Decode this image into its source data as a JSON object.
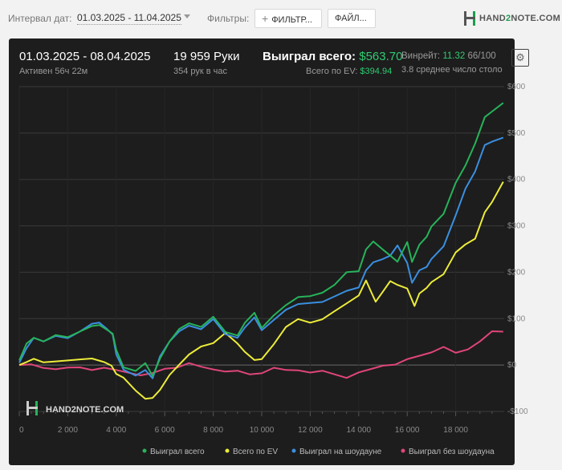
{
  "toolbar": {
    "date_label": "Интервал дат:",
    "date_range": "01.03.2025 - 11.04.2025",
    "filters_label": "Фильтры:",
    "filter_button": "ФИЛЬТР...",
    "files_button": "ФАЙЛ..."
  },
  "logo": {
    "pre": "HAND",
    "two": "2",
    "post": "NOTE.COM"
  },
  "summary": {
    "period": "01.03.2025 - 08.04.2025",
    "active": "Активен 56ч 22м",
    "hands": "19 959 Руки",
    "hands_per_hour": "354 рук в час",
    "won_label": "Выиграл всего:",
    "won_value": "$563.70",
    "ev_label": "Всего по EV:",
    "ev_value": "$394.94",
    "winrate_label": "Винрейт:",
    "winrate_value": "11.32",
    "winrate_unit": "66/100",
    "avg_tables": "3.8 среднее число столо"
  },
  "watermark": "HAND2NOTE.COM",
  "colors": {
    "won": "#27b35a",
    "ev": "#ecec3a",
    "showdown": "#3a8fe0",
    "nonshowdown": "#e0457a"
  },
  "chart_data": {
    "type": "line",
    "x_ticks": [
      "0",
      "2 000",
      "4 000",
      "6 000",
      "8 000",
      "10 000",
      "12 000",
      "14 000",
      "16 000",
      "18 000"
    ],
    "y_ticks": [
      "$600",
      "$500",
      "$400",
      "$300",
      "$200",
      "$100",
      "$0",
      "-$100"
    ],
    "xlim": [
      0,
      20000
    ],
    "ylim": [
      -100,
      600
    ],
    "grid": true,
    "legend_position": "bottom",
    "series": [
      {
        "name": "Выиграл всего",
        "color": "#27b35a",
        "x": [
          0,
          300,
          600,
          1000,
          1500,
          2000,
          2500,
          3000,
          3300,
          3600,
          3850,
          4000,
          4300,
          4800,
          5200,
          5500,
          5800,
          6200,
          6600,
          7000,
          7500,
          8000,
          8500,
          9000,
          9300,
          9700,
          10000,
          10500,
          11000,
          11500,
          12000,
          12500,
          13000,
          13500,
          14000,
          14300,
          14600,
          15000,
          15300,
          15600,
          16000,
          16200,
          16500,
          16800,
          17000,
          17500,
          18000,
          18400,
          18800,
          19200,
          19500,
          19959
        ],
        "y": [
          10,
          45,
          60,
          55,
          62,
          60,
          75,
          80,
          85,
          78,
          72,
          30,
          -5,
          -10,
          0,
          -25,
          15,
          55,
          75,
          90,
          85,
          100,
          70,
          65,
          95,
          110,
          80,
          110,
          125,
          145,
          150,
          160,
          170,
          200,
          205,
          245,
          265,
          250,
          240,
          220,
          265,
          225,
          255,
          275,
          300,
          330,
          390,
          430,
          480,
          530,
          545,
          565
        ]
      },
      {
        "name": "Всего по EV",
        "color": "#ecec3a",
        "x": [
          0,
          300,
          600,
          1000,
          1500,
          2000,
          2500,
          3000,
          3500,
          3800,
          4000,
          4300,
          4800,
          5200,
          5500,
          5800,
          6200,
          6600,
          7000,
          7500,
          8000,
          8500,
          9000,
          9300,
          9700,
          10000,
          10500,
          11000,
          11500,
          12000,
          12500,
          13000,
          13500,
          14000,
          14300,
          14500,
          14700,
          15000,
          15300,
          15600,
          16000,
          16300,
          16500,
          16800,
          17000,
          17500,
          18000,
          18400,
          18800,
          19200,
          19500,
          19959
        ],
        "y": [
          0,
          5,
          15,
          10,
          5,
          10,
          15,
          10,
          5,
          0,
          -15,
          -30,
          -55,
          -70,
          -75,
          -55,
          -20,
          5,
          20,
          40,
          50,
          65,
          45,
          30,
          15,
          10,
          45,
          85,
          95,
          90,
          100,
          120,
          130,
          150,
          185,
          155,
          135,
          160,
          185,
          170,
          165,
          130,
          150,
          165,
          180,
          200,
          240,
          260,
          275,
          325,
          350,
          395
        ]
      },
      {
        "name": "Выиграл на шоудауне",
        "color": "#3a8fe0",
        "x": [
          0,
          300,
          600,
          1000,
          1500,
          2000,
          2500,
          3000,
          3300,
          3600,
          3850,
          4000,
          4300,
          4800,
          5200,
          5500,
          5800,
          6200,
          6600,
          7000,
          7500,
          8000,
          8500,
          9000,
          9300,
          9700,
          10000,
          10500,
          11000,
          11500,
          12000,
          12500,
          13000,
          13500,
          14000,
          14300,
          14600,
          15000,
          15300,
          15600,
          16000,
          16200,
          16500,
          16800,
          17000,
          17500,
          18000,
          18400,
          18800,
          19200,
          19500,
          19959
        ],
        "y": [
          5,
          35,
          60,
          55,
          60,
          58,
          75,
          85,
          90,
          80,
          70,
          20,
          -10,
          -20,
          -15,
          -30,
          20,
          55,
          70,
          85,
          80,
          95,
          65,
          60,
          85,
          100,
          75,
          100,
          115,
          130,
          135,
          140,
          145,
          160,
          170,
          200,
          220,
          230,
          240,
          255,
          220,
          180,
          200,
          210,
          230,
          260,
          320,
          380,
          420,
          470,
          480,
          490
        ]
      },
      {
        "name": "Выиграл без шоудауна",
        "color": "#e0457a",
        "x": [
          0,
          500,
          1000,
          1500,
          2000,
          2500,
          3000,
          3500,
          4000,
          4500,
          5000,
          5500,
          6000,
          6500,
          7000,
          7500,
          8000,
          8500,
          9000,
          9500,
          10000,
          10500,
          11000,
          11500,
          12000,
          12500,
          13000,
          13500,
          14000,
          14500,
          15000,
          15500,
          16000,
          16500,
          17000,
          17500,
          18000,
          18500,
          19000,
          19500,
          19959
        ],
        "y": [
          0,
          0,
          -5,
          -5,
          -8,
          -5,
          -8,
          -10,
          -12,
          -15,
          -18,
          -20,
          -8,
          -3,
          0,
          -5,
          -8,
          -10,
          -15,
          -20,
          -15,
          -10,
          -12,
          -10,
          -12,
          -15,
          -20,
          -25,
          -20,
          -10,
          0,
          5,
          10,
          20,
          30,
          35,
          25,
          35,
          55,
          70,
          72
        ]
      }
    ]
  }
}
